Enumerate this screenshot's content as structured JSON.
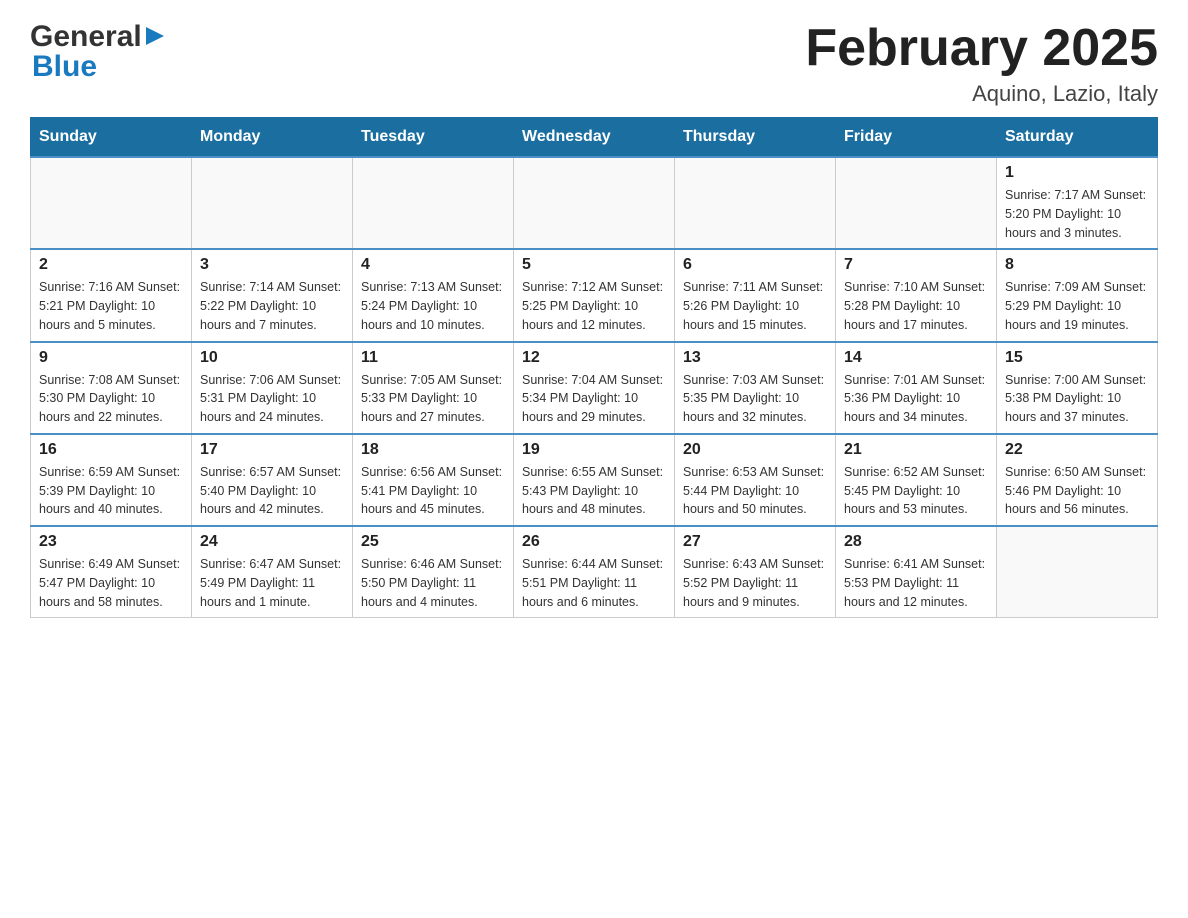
{
  "header": {
    "logo": {
      "general": "General",
      "blue": "Blue",
      "alt": "GeneralBlue logo"
    },
    "title": "February 2025",
    "location": "Aquino, Lazio, Italy"
  },
  "calendar": {
    "days_of_week": [
      "Sunday",
      "Monday",
      "Tuesday",
      "Wednesday",
      "Thursday",
      "Friday",
      "Saturday"
    ],
    "weeks": [
      [
        {
          "day": "",
          "info": ""
        },
        {
          "day": "",
          "info": ""
        },
        {
          "day": "",
          "info": ""
        },
        {
          "day": "",
          "info": ""
        },
        {
          "day": "",
          "info": ""
        },
        {
          "day": "",
          "info": ""
        },
        {
          "day": "1",
          "info": "Sunrise: 7:17 AM\nSunset: 5:20 PM\nDaylight: 10 hours and 3 minutes."
        }
      ],
      [
        {
          "day": "2",
          "info": "Sunrise: 7:16 AM\nSunset: 5:21 PM\nDaylight: 10 hours and 5 minutes."
        },
        {
          "day": "3",
          "info": "Sunrise: 7:14 AM\nSunset: 5:22 PM\nDaylight: 10 hours and 7 minutes."
        },
        {
          "day": "4",
          "info": "Sunrise: 7:13 AM\nSunset: 5:24 PM\nDaylight: 10 hours and 10 minutes."
        },
        {
          "day": "5",
          "info": "Sunrise: 7:12 AM\nSunset: 5:25 PM\nDaylight: 10 hours and 12 minutes."
        },
        {
          "day": "6",
          "info": "Sunrise: 7:11 AM\nSunset: 5:26 PM\nDaylight: 10 hours and 15 minutes."
        },
        {
          "day": "7",
          "info": "Sunrise: 7:10 AM\nSunset: 5:28 PM\nDaylight: 10 hours and 17 minutes."
        },
        {
          "day": "8",
          "info": "Sunrise: 7:09 AM\nSunset: 5:29 PM\nDaylight: 10 hours and 19 minutes."
        }
      ],
      [
        {
          "day": "9",
          "info": "Sunrise: 7:08 AM\nSunset: 5:30 PM\nDaylight: 10 hours and 22 minutes."
        },
        {
          "day": "10",
          "info": "Sunrise: 7:06 AM\nSunset: 5:31 PM\nDaylight: 10 hours and 24 minutes."
        },
        {
          "day": "11",
          "info": "Sunrise: 7:05 AM\nSunset: 5:33 PM\nDaylight: 10 hours and 27 minutes."
        },
        {
          "day": "12",
          "info": "Sunrise: 7:04 AM\nSunset: 5:34 PM\nDaylight: 10 hours and 29 minutes."
        },
        {
          "day": "13",
          "info": "Sunrise: 7:03 AM\nSunset: 5:35 PM\nDaylight: 10 hours and 32 minutes."
        },
        {
          "day": "14",
          "info": "Sunrise: 7:01 AM\nSunset: 5:36 PM\nDaylight: 10 hours and 34 minutes."
        },
        {
          "day": "15",
          "info": "Sunrise: 7:00 AM\nSunset: 5:38 PM\nDaylight: 10 hours and 37 minutes."
        }
      ],
      [
        {
          "day": "16",
          "info": "Sunrise: 6:59 AM\nSunset: 5:39 PM\nDaylight: 10 hours and 40 minutes."
        },
        {
          "day": "17",
          "info": "Sunrise: 6:57 AM\nSunset: 5:40 PM\nDaylight: 10 hours and 42 minutes."
        },
        {
          "day": "18",
          "info": "Sunrise: 6:56 AM\nSunset: 5:41 PM\nDaylight: 10 hours and 45 minutes."
        },
        {
          "day": "19",
          "info": "Sunrise: 6:55 AM\nSunset: 5:43 PM\nDaylight: 10 hours and 48 minutes."
        },
        {
          "day": "20",
          "info": "Sunrise: 6:53 AM\nSunset: 5:44 PM\nDaylight: 10 hours and 50 minutes."
        },
        {
          "day": "21",
          "info": "Sunrise: 6:52 AM\nSunset: 5:45 PM\nDaylight: 10 hours and 53 minutes."
        },
        {
          "day": "22",
          "info": "Sunrise: 6:50 AM\nSunset: 5:46 PM\nDaylight: 10 hours and 56 minutes."
        }
      ],
      [
        {
          "day": "23",
          "info": "Sunrise: 6:49 AM\nSunset: 5:47 PM\nDaylight: 10 hours and 58 minutes."
        },
        {
          "day": "24",
          "info": "Sunrise: 6:47 AM\nSunset: 5:49 PM\nDaylight: 11 hours and 1 minute."
        },
        {
          "day": "25",
          "info": "Sunrise: 6:46 AM\nSunset: 5:50 PM\nDaylight: 11 hours and 4 minutes."
        },
        {
          "day": "26",
          "info": "Sunrise: 6:44 AM\nSunset: 5:51 PM\nDaylight: 11 hours and 6 minutes."
        },
        {
          "day": "27",
          "info": "Sunrise: 6:43 AM\nSunset: 5:52 PM\nDaylight: 11 hours and 9 minutes."
        },
        {
          "day": "28",
          "info": "Sunrise: 6:41 AM\nSunset: 5:53 PM\nDaylight: 11 hours and 12 minutes."
        },
        {
          "day": "",
          "info": ""
        }
      ]
    ]
  }
}
